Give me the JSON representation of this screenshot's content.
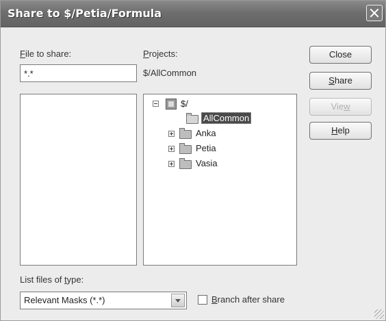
{
  "window": {
    "title": "Share to $/Petia/Formula"
  },
  "file_section": {
    "label_hotkey": "F",
    "label_rest": "ile to share:",
    "filter_value": "*.*"
  },
  "projects_section": {
    "label_hotkey": "P",
    "label_rest": "rojects:",
    "current_path": "$/AllCommon"
  },
  "tree": {
    "root": "$/",
    "children": [
      {
        "label": "AllCommon",
        "selected": true,
        "expandable": false
      },
      {
        "label": "Anka",
        "selected": false,
        "expandable": true
      },
      {
        "label": "Petia",
        "selected": false,
        "expandable": true
      },
      {
        "label": "Vasia",
        "selected": false,
        "expandable": true
      }
    ]
  },
  "buttons": {
    "close": "Close",
    "share_hotkey": "S",
    "share_rest": "hare",
    "view_pre": "Vie",
    "view_hotkey": "w",
    "help_hotkey": "H",
    "help_rest": "elp"
  },
  "file_type": {
    "label_pre": "List files of ",
    "label_hotkey": "t",
    "label_rest": "ype:",
    "selected": "Relevant Masks (*.*)"
  },
  "branch_option": {
    "label_hotkey": "B",
    "label_rest": "ranch after share",
    "checked": false
  }
}
